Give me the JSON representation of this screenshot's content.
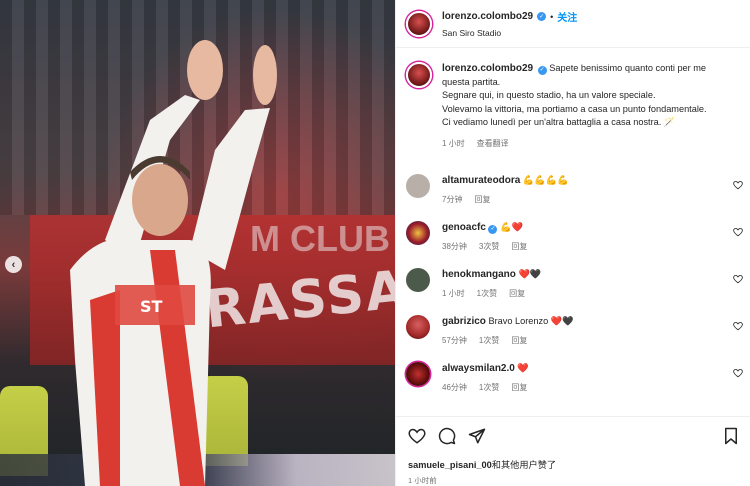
{
  "post": {
    "username": "lorenzo.colombo29",
    "follow_label": "关注",
    "dot": "•",
    "location": "San Siro Stadio",
    "caption_lines": [
      "Sapete benissimo quanto conti per me questa partita.",
      "Segnare qui, in questo stadio, ha un valore speciale.",
      "Volevamo la vittoria, ma portiamo a casa un punto fondamentale.",
      "Ci vediamo lunedì per un'altra battaglia a casa nostra. 🪄"
    ],
    "caption_time": "1 小时",
    "translate_label": "查看翻译"
  },
  "photo": {
    "banner_text": "RASSA",
    "club_text": "M CLUB"
  },
  "comments": [
    {
      "username": "altamurateodora",
      "text": "💪💪💪💪",
      "time": "7分钟",
      "likes": "",
      "reply": "回复",
      "avatar_color": "#b8b0a8"
    },
    {
      "username": "genoacfc",
      "text": "💪❤️",
      "time": "38分钟",
      "likes": "3次赞",
      "reply": "回复",
      "avatar_color": "#9a1c2a"
    },
    {
      "username": "henokmangano",
      "text": "❤️🖤",
      "time": "1 小时",
      "likes": "1次赞",
      "reply": "回复",
      "avatar_color": "#4b5a4a"
    },
    {
      "username": "gabrizico",
      "text": "Bravo Lorenzo ❤️🖤",
      "time": "57分钟",
      "likes": "1次赞",
      "reply": "回复",
      "avatar_color": "#a32828"
    },
    {
      "username": "alwaysmilan2.0",
      "text": "❤️",
      "time": "46分钟",
      "likes": "1次赞",
      "reply": "回复",
      "avatar_color": "#5e0c0c"
    }
  ],
  "footer": {
    "likes_user": "samuele_pisani_00",
    "likes_suffix": "和其他用户赞了",
    "time": "1 小时前"
  },
  "icons": [
    "chevron-left-icon",
    "heart-icon",
    "comment-icon",
    "share-icon",
    "bookmark-icon",
    "verified-icon"
  ]
}
